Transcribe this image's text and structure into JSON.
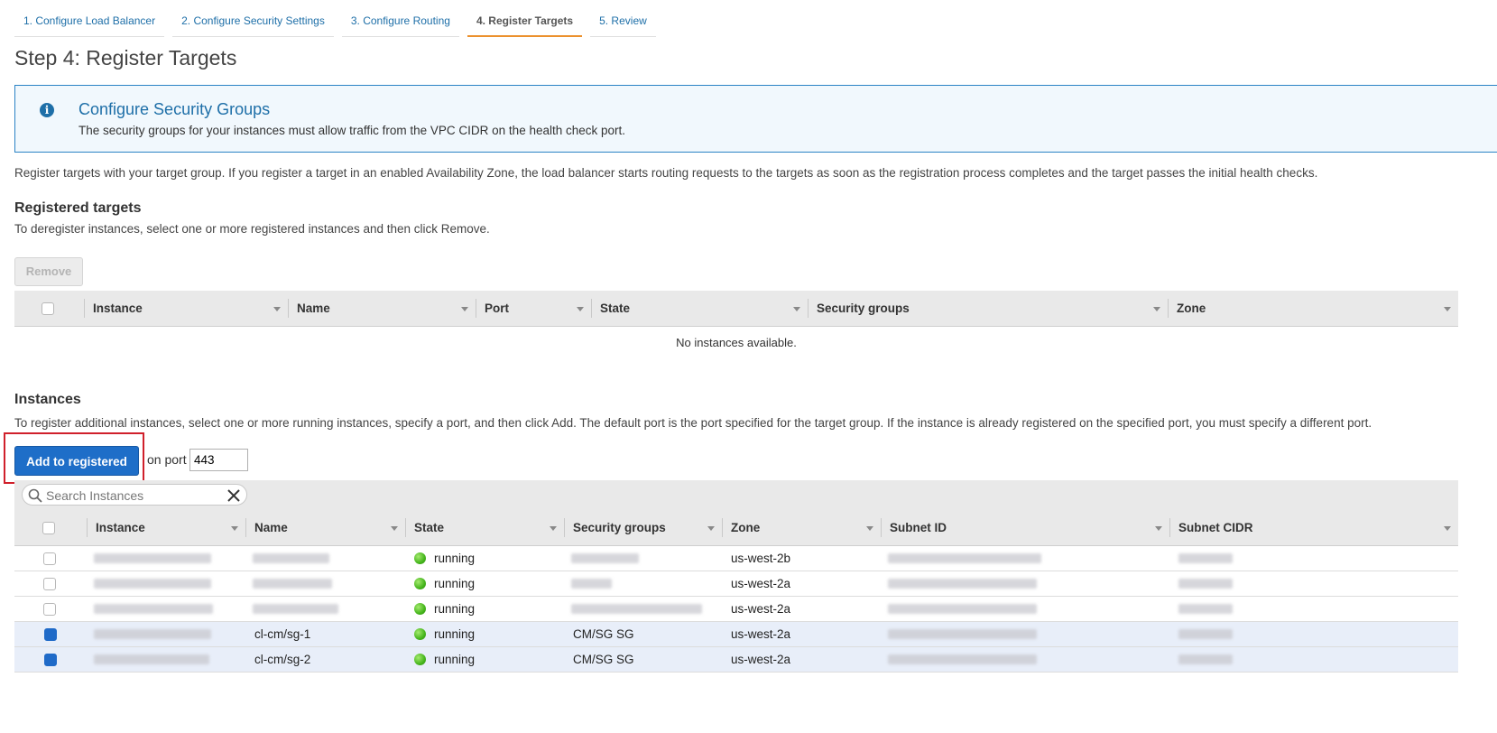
{
  "wizard": {
    "tabs": [
      {
        "label": "1. Configure Load Balancer"
      },
      {
        "label": "2. Configure Security Settings"
      },
      {
        "label": "3. Configure Routing"
      },
      {
        "label": "4. Register Targets",
        "active": true
      },
      {
        "label": "5. Review"
      }
    ]
  },
  "page": {
    "title": "Step 4: Register Targets"
  },
  "info": {
    "icon": "info-circle-icon",
    "title": "Configure Security Groups",
    "text": "The security groups for your instances must allow traffic from the VPC CIDR on the health check port."
  },
  "intro": "Register targets with your target group. If you register a target in an enabled Availability Zone, the load balancer starts routing requests to the targets as soon as the registration process completes and the target passes the initial health checks.",
  "registered": {
    "title": "Registered targets",
    "description": "To deregister instances, select one or more registered instances and then click Remove.",
    "remove_label": "Remove",
    "columns": [
      "Instance",
      "Name",
      "Port",
      "State",
      "Security groups",
      "Zone"
    ],
    "empty_text": "No instances available."
  },
  "instances": {
    "title": "Instances",
    "description": "To register additional instances, select one or more running instances, specify a port, and then click Add. The default port is the port specified for the target group. If the instance is already registered on the specified port, you must specify a different port.",
    "add_label": "Add to registered",
    "port_label": "on port",
    "port_value": "443",
    "search_placeholder": "Search Instances",
    "columns": [
      "Instance",
      "Name",
      "State",
      "Security groups",
      "Zone",
      "Subnet ID",
      "Subnet CIDR"
    ],
    "rows": [
      {
        "name": "",
        "state": "running",
        "security_groups": "",
        "zone": "us-west-2b",
        "checked": false
      },
      {
        "name": "",
        "state": "running",
        "security_groups": "",
        "zone": "us-west-2a",
        "checked": false
      },
      {
        "name": "",
        "state": "running",
        "security_groups": "",
        "zone": "us-west-2a",
        "checked": false
      },
      {
        "name": "cl-cm/sg-1",
        "state": "running",
        "security_groups": "CM/SG SG",
        "zone": "us-west-2a",
        "checked": true
      },
      {
        "name": "cl-cm/sg-2",
        "state": "running",
        "security_groups": "CM/SG SG",
        "zone": "us-west-2a",
        "checked": true
      }
    ]
  },
  "colors": {
    "primary": "#1e6ec8",
    "link": "#1e6fa8",
    "active_tab_underline": "#ec912d",
    "highlight_border": "#d0202b",
    "running": "#45b51c",
    "selected_row": "#e8eef9"
  }
}
